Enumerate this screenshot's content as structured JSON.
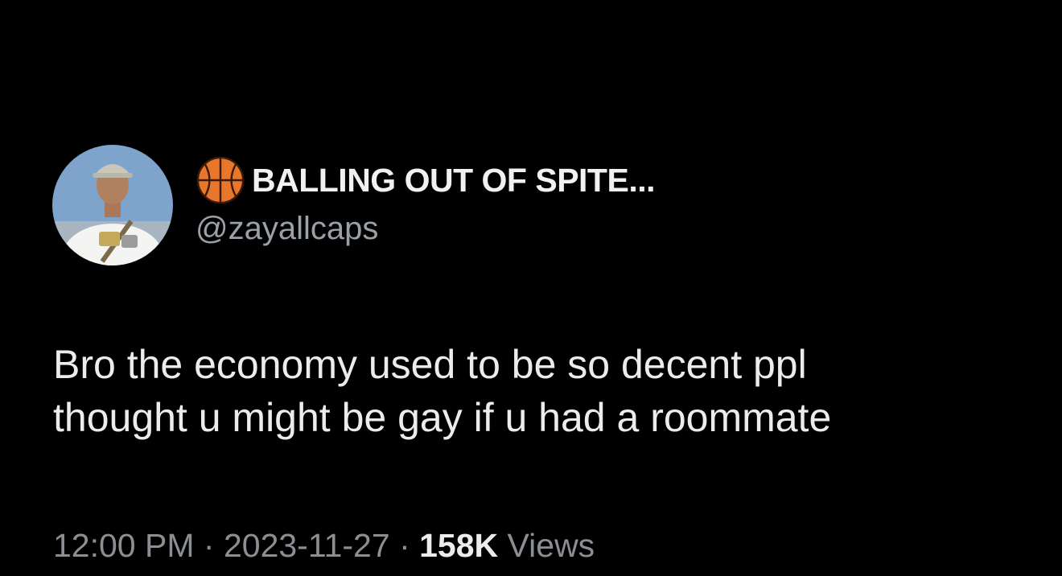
{
  "tweet": {
    "display_name": "BALLING OUT OF SPITE...",
    "handle": "@zayallcaps",
    "text_lines": [
      "Bro the economy used to be so decent ppl",
      "thought u might be gay if u had a roommate"
    ],
    "time": "12:00 PM",
    "separator": "·",
    "date": "2023-11-27",
    "views_count": "158K",
    "views_label": "Views"
  },
  "icons": {
    "name_emoji": "basketball-icon",
    "avatar": "profile-photo"
  },
  "colors": {
    "background": "#000000",
    "primary_text": "#ececec",
    "secondary_text": "#8b8f94",
    "basketball": "#e8762b"
  }
}
